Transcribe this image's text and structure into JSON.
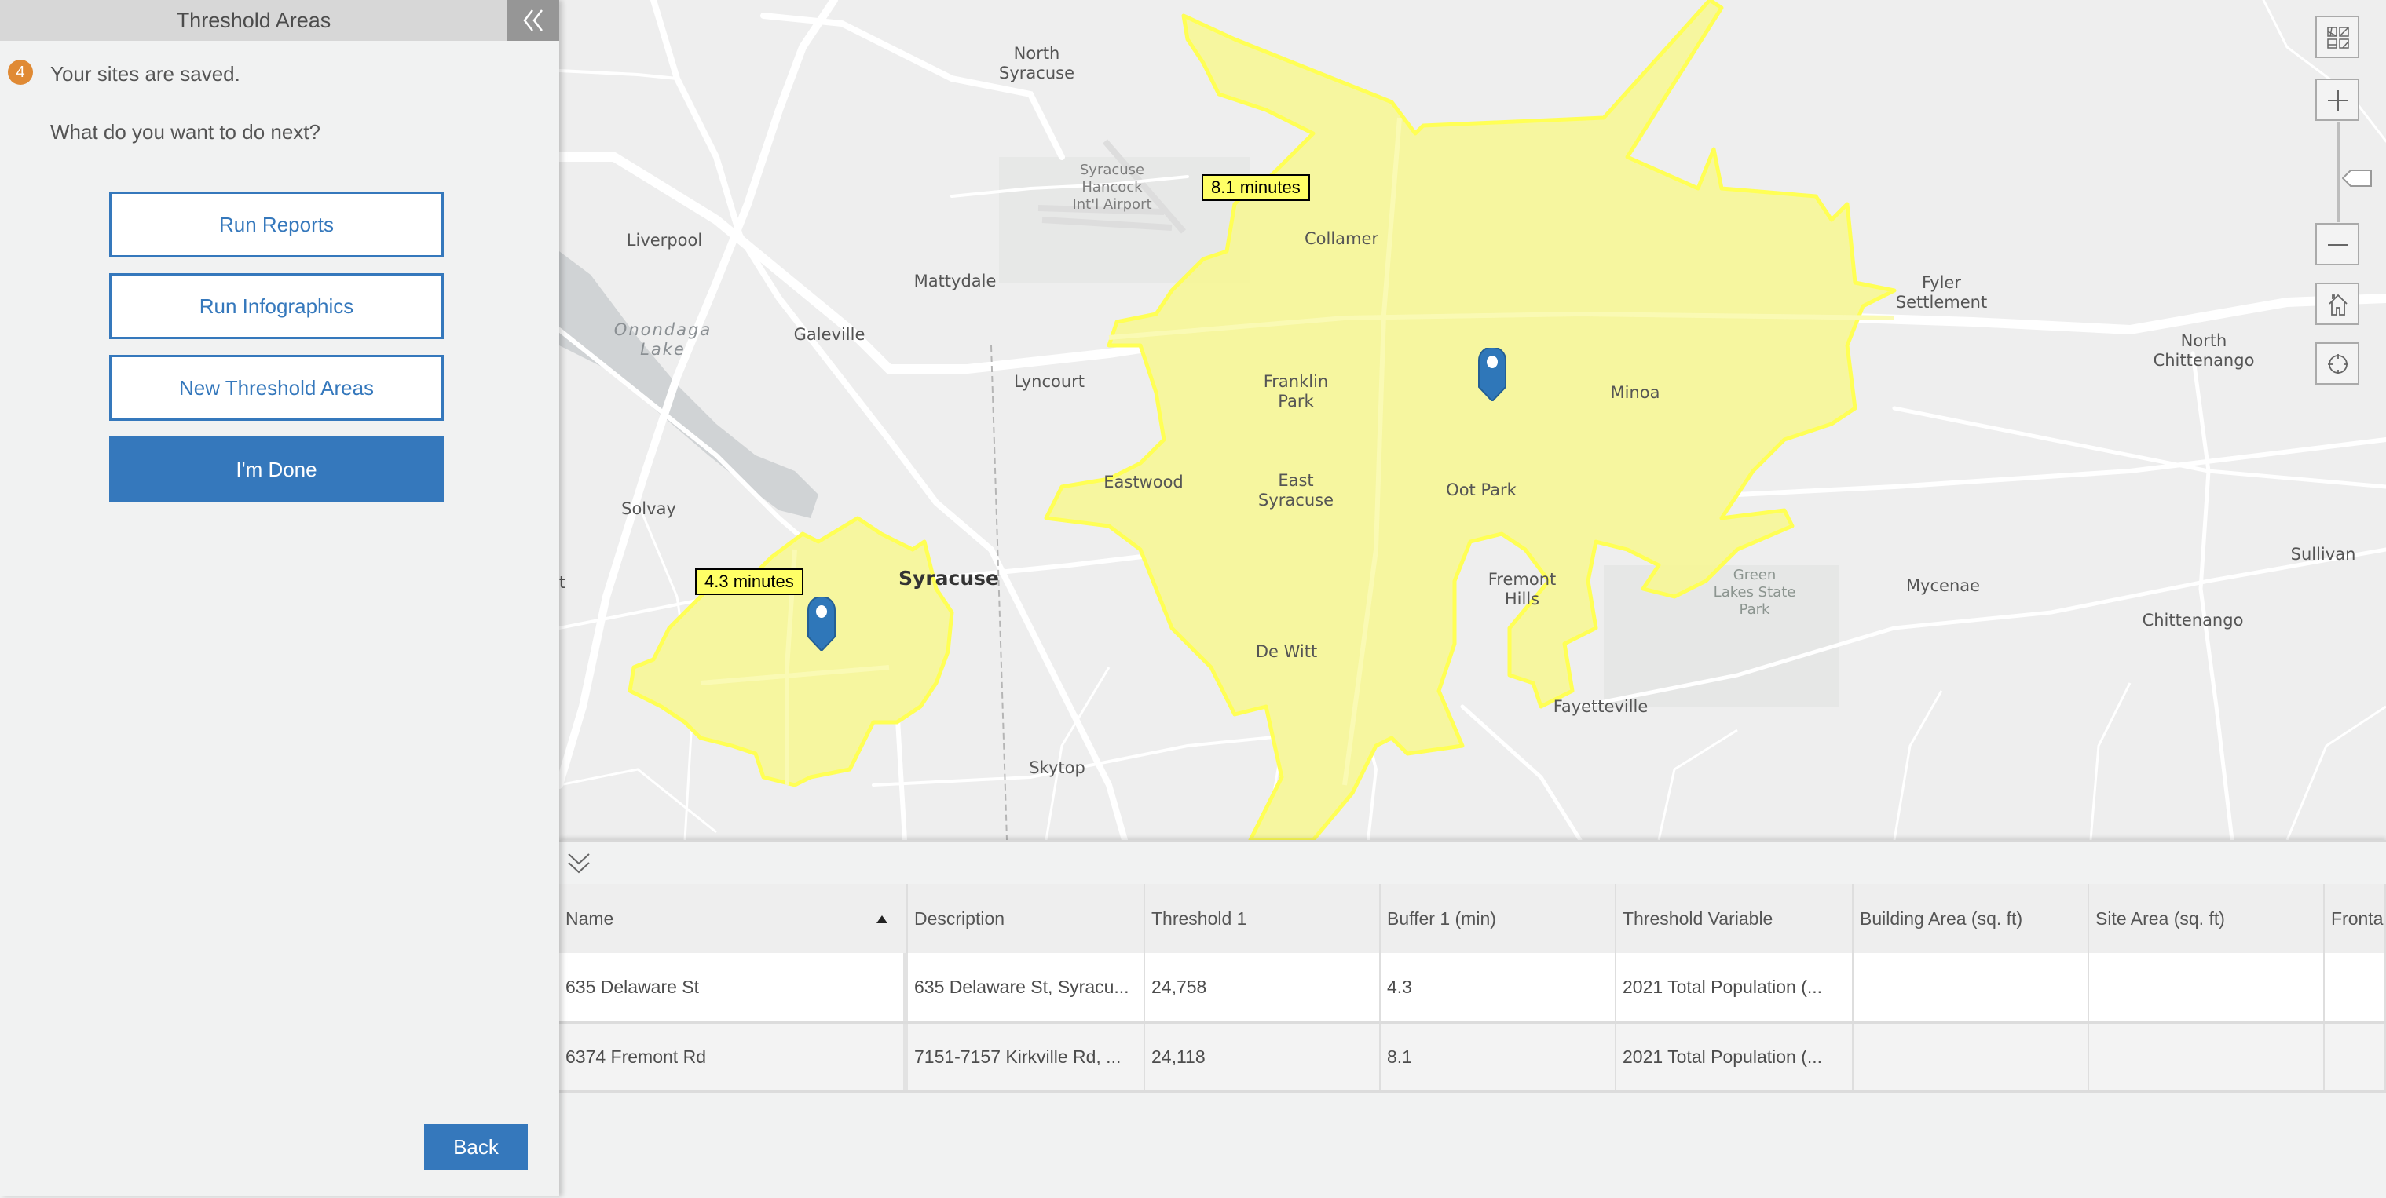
{
  "panel": {
    "title": "Threshold Areas",
    "collapse_icon": "double-chevron-left",
    "step_number": "4",
    "step_text": "Your sites are saved.",
    "question": "What do you want to do next?",
    "buttons": [
      {
        "label": "Run Reports",
        "style": "outline"
      },
      {
        "label": "Run Infographics",
        "style": "outline"
      },
      {
        "label": "New Threshold Areas",
        "style": "outline"
      },
      {
        "label": "I'm Done",
        "style": "primary"
      }
    ],
    "back_label": "Back"
  },
  "colors": {
    "accent": "#3578bc",
    "step_badge": "#e08a34",
    "drive_time_fill": "#f5f59a",
    "drive_time_outline": "#ffff55",
    "label_bg": "#ffff66",
    "pin": "#2f77b9"
  },
  "map": {
    "places": [
      {
        "name": "North\nSyracuse",
        "kind": "town"
      },
      {
        "name": "Syracuse\nHancock\nInt'l Airport",
        "kind": "airport"
      },
      {
        "name": "Liverpool",
        "kind": "town"
      },
      {
        "name": "Mattydale",
        "kind": "town"
      },
      {
        "name": "Collamer",
        "kind": "town"
      },
      {
        "name": "Onondaga\nLake",
        "kind": "water"
      },
      {
        "name": "Galeville",
        "kind": "town"
      },
      {
        "name": "Lyncourt",
        "kind": "town"
      },
      {
        "name": "Franklin\nPark",
        "kind": "town"
      },
      {
        "name": "Minoa",
        "kind": "town"
      },
      {
        "name": "Fyler\nSettlement",
        "kind": "town"
      },
      {
        "name": "North\nChittenango",
        "kind": "town"
      },
      {
        "name": "Eastwood",
        "kind": "town"
      },
      {
        "name": "East\nSyracuse",
        "kind": "town"
      },
      {
        "name": "Oot Park",
        "kind": "town"
      },
      {
        "name": "Solvay",
        "kind": "town"
      },
      {
        "name": "Syracuse",
        "kind": "city"
      },
      {
        "name": "Fremont\nHills",
        "kind": "town"
      },
      {
        "name": "Green\nLakes State\nPark",
        "kind": "park"
      },
      {
        "name": "Mycenae",
        "kind": "town"
      },
      {
        "name": "Sullivan",
        "kind": "town"
      },
      {
        "name": "Chittenango",
        "kind": "town"
      },
      {
        "name": "De Witt",
        "kind": "town"
      },
      {
        "name": "Fayetteville",
        "kind": "town"
      },
      {
        "name": "Skytop",
        "kind": "town"
      },
      {
        "name": "t",
        "kind": "town"
      }
    ],
    "drive_time_labels": [
      "8.1 minutes",
      "4.3 minutes"
    ],
    "controls": [
      "basemap-gallery",
      "zoom-in",
      "zoom-slider",
      "zoom-out",
      "home",
      "locate"
    ]
  },
  "table": {
    "toggle_icon": "double-chevron-down",
    "sort_column": "Name",
    "sort_direction": "ascending",
    "columns": [
      "Name",
      "Description",
      "Threshold 1",
      "Buffer 1 (min)",
      "Threshold Variable",
      "Building Area (sq. ft)",
      "Site Area (sq. ft)",
      "Fronta"
    ],
    "rows": [
      [
        "635 Delaware St",
        "635 Delaware St, Syracu...",
        "24,758",
        "4.3",
        "2021 Total Population (...",
        "",
        "",
        ""
      ],
      [
        "6374 Fremont Rd",
        "7151-7157 Kirkville Rd, ...",
        "24,118",
        "8.1",
        "2021 Total Population (...",
        "",
        "",
        ""
      ]
    ]
  }
}
